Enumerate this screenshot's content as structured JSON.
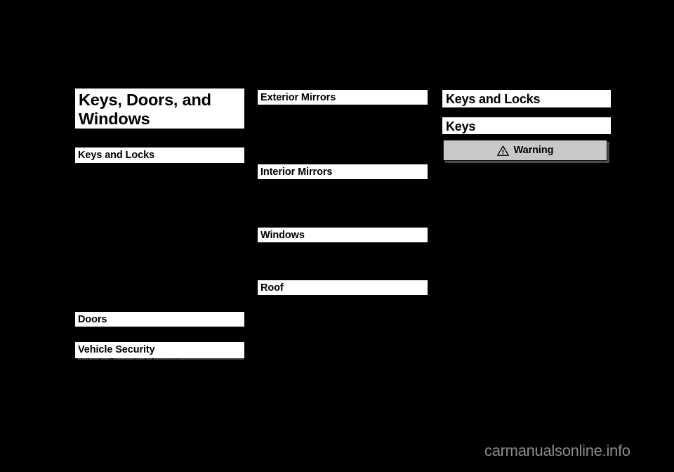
{
  "page": {
    "background_color": "#000000",
    "text_color": "#000000",
    "bar_color": "#ffffff"
  },
  "chapter": {
    "title": "Keys, Doors, and Windows"
  },
  "columns": {
    "left": {
      "headings": [
        {
          "label": "Keys and Locks"
        },
        {
          "label": "Doors"
        },
        {
          "label": "Vehicle Security"
        }
      ],
      "cut_off_line": "Vehicle Security Information"
    },
    "middle": {
      "headings": [
        {
          "label": "Exterior Mirrors"
        },
        {
          "label": "Interior Mirrors"
        },
        {
          "label": "Windows"
        },
        {
          "label": "Roof"
        }
      ]
    },
    "right": {
      "section_heading": "Keys and Locks",
      "sub_heading": "Keys",
      "warning": {
        "label": "Warning",
        "icon": "warning-triangle-icon",
        "fill_color": "#c8c8c8",
        "border_color": "#1a1a1a",
        "shadow_color": "#4a4a4a"
      }
    }
  },
  "watermark": {
    "text": "carmanualsonline.info",
    "color": "#8a8a8a"
  }
}
